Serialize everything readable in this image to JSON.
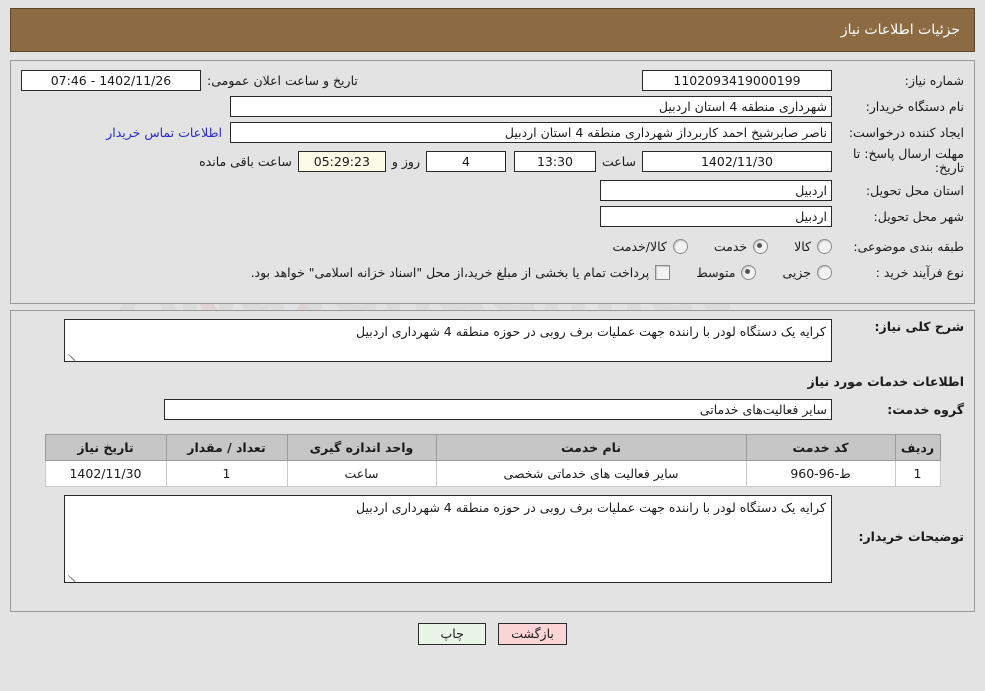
{
  "header": {
    "title": "جزئیات اطلاعات نیاز"
  },
  "watermark": {
    "text": "AriaTender.net",
    "icon": "shield-logo"
  },
  "summary": {
    "need_number_label": "شماره نیاز:",
    "need_number_value": "1102093419000199",
    "announce_label": "تاریخ و ساعت اعلان عمومی:",
    "announce_value": "07:46 - 1402/11/26",
    "buyer_org_label": "نام دستگاه خریدار:",
    "buyer_org_value": "شهرداری منطقه 4 استان اردبیل",
    "creator_label": "ایجاد کننده درخواست:",
    "creator_value": "ناصر صابرشیخ احمد کاربرداز شهرداری منطقه 4 استان اردبیل",
    "contact_link": "اطلاعات تماس خریدار",
    "deadline_label": "مهلت ارسال پاسخ: تا تاریخ:",
    "deadline_date": "1402/11/30",
    "hour_label": "ساعت",
    "deadline_hour": "13:30",
    "remaining_days": "4",
    "days_and_label": "روز و",
    "remaining_time": "05:29:23",
    "remaining_suffix": "ساعت باقی مانده",
    "province_label": "استان محل تحویل:",
    "province_value": "اردبیل",
    "city_label": "شهر محل تحویل:",
    "city_value": "اردبیل",
    "category_label": "طبقه بندی موضوعی:",
    "category_options": [
      {
        "label": "کالا",
        "selected": false
      },
      {
        "label": "خدمت",
        "selected": true
      },
      {
        "label": "کالا/خدمت",
        "selected": false
      }
    ],
    "process_label": "نوع فرآیند خرید :",
    "process_options": [
      {
        "label": "جزیی",
        "selected": false
      },
      {
        "label": "متوسط",
        "selected": true
      }
    ],
    "treasury_checkbox_checked": false,
    "treasury_note": "پرداخت تمام یا بخشی از مبلغ خرید،از محل \"اسناد خزانه اسلامی\" خواهد بود."
  },
  "details": {
    "need_desc_label": "شرح کلی نیاز:",
    "need_desc_value": "کرایه یک دستگاه لودر با راننده جهت عملیات برف روبی در حوزه منطقه 4 شهرداری اردبیل",
    "services_heading": "اطلاعات خدمات مورد نیاز",
    "service_group_label": "گروه خدمت:",
    "service_group_value": "سایر فعالیت‌های خدماتی",
    "table": {
      "columns": [
        "ردیف",
        "کد خدمت",
        "نام خدمت",
        "واحد اندازه گیری",
        "تعداد / مقدار",
        "تاریخ نیاز"
      ],
      "rows": [
        {
          "row_no": "1",
          "service_code": "ط-96-960",
          "service_name": "سایر فعالیت های خدماتی شخصی",
          "unit": "ساعت",
          "quantity": "1",
          "need_date": "1402/11/30"
        }
      ]
    },
    "buyer_notes_label": "توضیحات خریدار:",
    "buyer_notes_value": "کرایه یک دستگاه لودر با راننده جهت عملیات برف روبی در حوزه منطقه 4 شهرداری اردبیل"
  },
  "footer": {
    "print_label": "چاپ",
    "back_label": "بازگشت"
  },
  "colors": {
    "header_bg": "#8c6b43",
    "page_bg": "#e3e3e3",
    "link": "#2b2bc8",
    "print_btn": "#e9f5e6",
    "back_btn": "#fbd5d5",
    "table_header": "#c6c6c6",
    "highlight_field": "#fbfbe8"
  }
}
